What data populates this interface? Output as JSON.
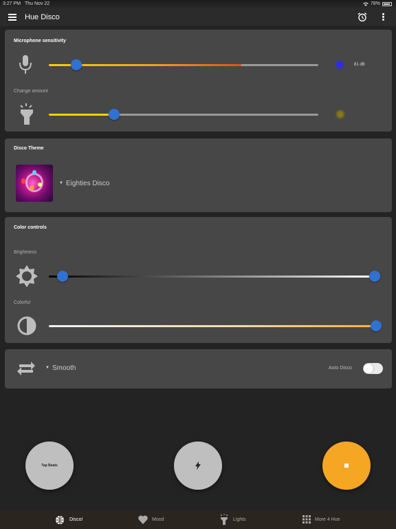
{
  "status_bar": {
    "time": "3:27 PM",
    "date": "Thu Nov 22",
    "battery": "78%"
  },
  "app_bar": {
    "title": "Hue Disco",
    "icons": [
      "menu-icon",
      "alarm-icon",
      "more-vert-icon"
    ]
  },
  "mic_card": {
    "title": "Microphone sensitivity",
    "mic_slider_value": 0.1,
    "db_label": "81 dB",
    "change_amount_label": "Change amount",
    "change_slider_value": 0.24
  },
  "theme_card": {
    "title": "Disco Theme",
    "selected_theme": "Eighties Disco"
  },
  "color_card": {
    "title": "Color controls",
    "brightness_label": "Brightness",
    "brightness_low": 0.04,
    "brightness_high": 1.0,
    "colorful_label": "Colorful",
    "colorful_value": 1.0
  },
  "transition_card": {
    "mode": "Smooth",
    "auto_disco_label": "Auto Disco",
    "auto_disco_on": false
  },
  "buttons": {
    "tap_beats": "Tap Beats",
    "accent": "#f5a623"
  },
  "nav": {
    "items": [
      "Disco!",
      "Mood",
      "Lights",
      "More 4 Hue"
    ],
    "active": "Disco!"
  }
}
